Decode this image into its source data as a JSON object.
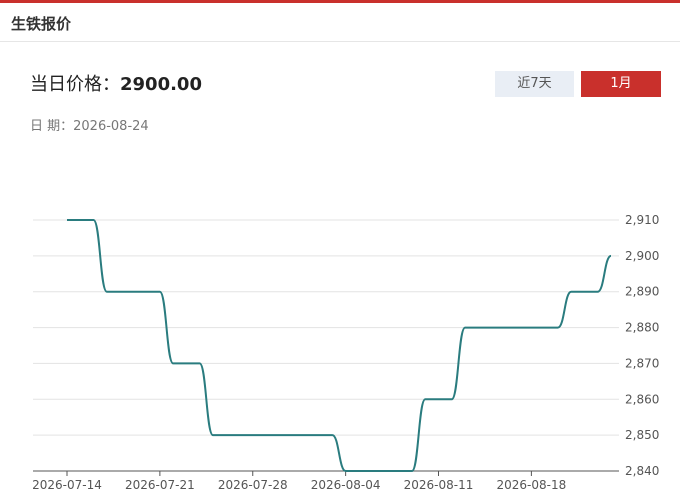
{
  "header": {
    "title": "生铁报价"
  },
  "price": {
    "label": "当日价格：",
    "value": "2900.00"
  },
  "date": {
    "label": "日 期：",
    "value": "2026-08-24"
  },
  "tabs": [
    {
      "label": "近7天",
      "active": false
    },
    {
      "label": "1月",
      "active": true
    }
  ],
  "colors": {
    "accent": "#c9302c",
    "line": "#2a7c7f",
    "tab_inactive_bg": "#e9eef5"
  },
  "chart_data": {
    "type": "line",
    "x": [
      "2026-07-14",
      "2026-07-15",
      "2026-07-16",
      "2026-07-17",
      "2026-07-18",
      "2026-07-19",
      "2026-07-20",
      "2026-07-21",
      "2026-07-22",
      "2026-07-23",
      "2026-07-24",
      "2026-07-25",
      "2026-07-26",
      "2026-07-27",
      "2026-07-28",
      "2026-07-29",
      "2026-07-30",
      "2026-07-31",
      "2026-08-01",
      "2026-08-02",
      "2026-08-03",
      "2026-08-04",
      "2026-08-05",
      "2026-08-06",
      "2026-08-07",
      "2026-08-08",
      "2026-08-09",
      "2026-08-10",
      "2026-08-11",
      "2026-08-12",
      "2026-08-13",
      "2026-08-14",
      "2026-08-15",
      "2026-08-16",
      "2026-08-17",
      "2026-08-18",
      "2026-08-19",
      "2026-08-20",
      "2026-08-21",
      "2026-08-22",
      "2026-08-23",
      "2026-08-24"
    ],
    "series": [
      {
        "values": [
          2910,
          2910,
          2910,
          2890,
          2890,
          2890,
          2890,
          2890,
          2870,
          2870,
          2870,
          2850,
          2850,
          2850,
          2850,
          2850,
          2850,
          2850,
          2850,
          2850,
          2850,
          2840,
          2840,
          2840,
          2840,
          2840,
          2840,
          2860,
          2860,
          2860,
          2880,
          2880,
          2880,
          2880,
          2880,
          2880,
          2880,
          2880,
          2890,
          2890,
          2890,
          2900
        ]
      }
    ],
    "x_tick_labels": [
      "2026-07-14",
      "2026-07-21",
      "2026-07-28",
      "2026-08-04",
      "2026-08-11",
      "2026-08-18"
    ],
    "y_ticks": [
      2840,
      2850,
      2860,
      2870,
      2880,
      2890,
      2900,
      2910
    ],
    "y_tick_labels": [
      "2,840",
      "2,850",
      "2,860",
      "2,870",
      "2,880",
      "2,890",
      "2,900",
      "2,910"
    ],
    "ylim": [
      2840,
      2910
    ],
    "title": "",
    "xlabel": "",
    "ylabel": "",
    "grid": "horizontal",
    "y_axis_position": "right"
  }
}
